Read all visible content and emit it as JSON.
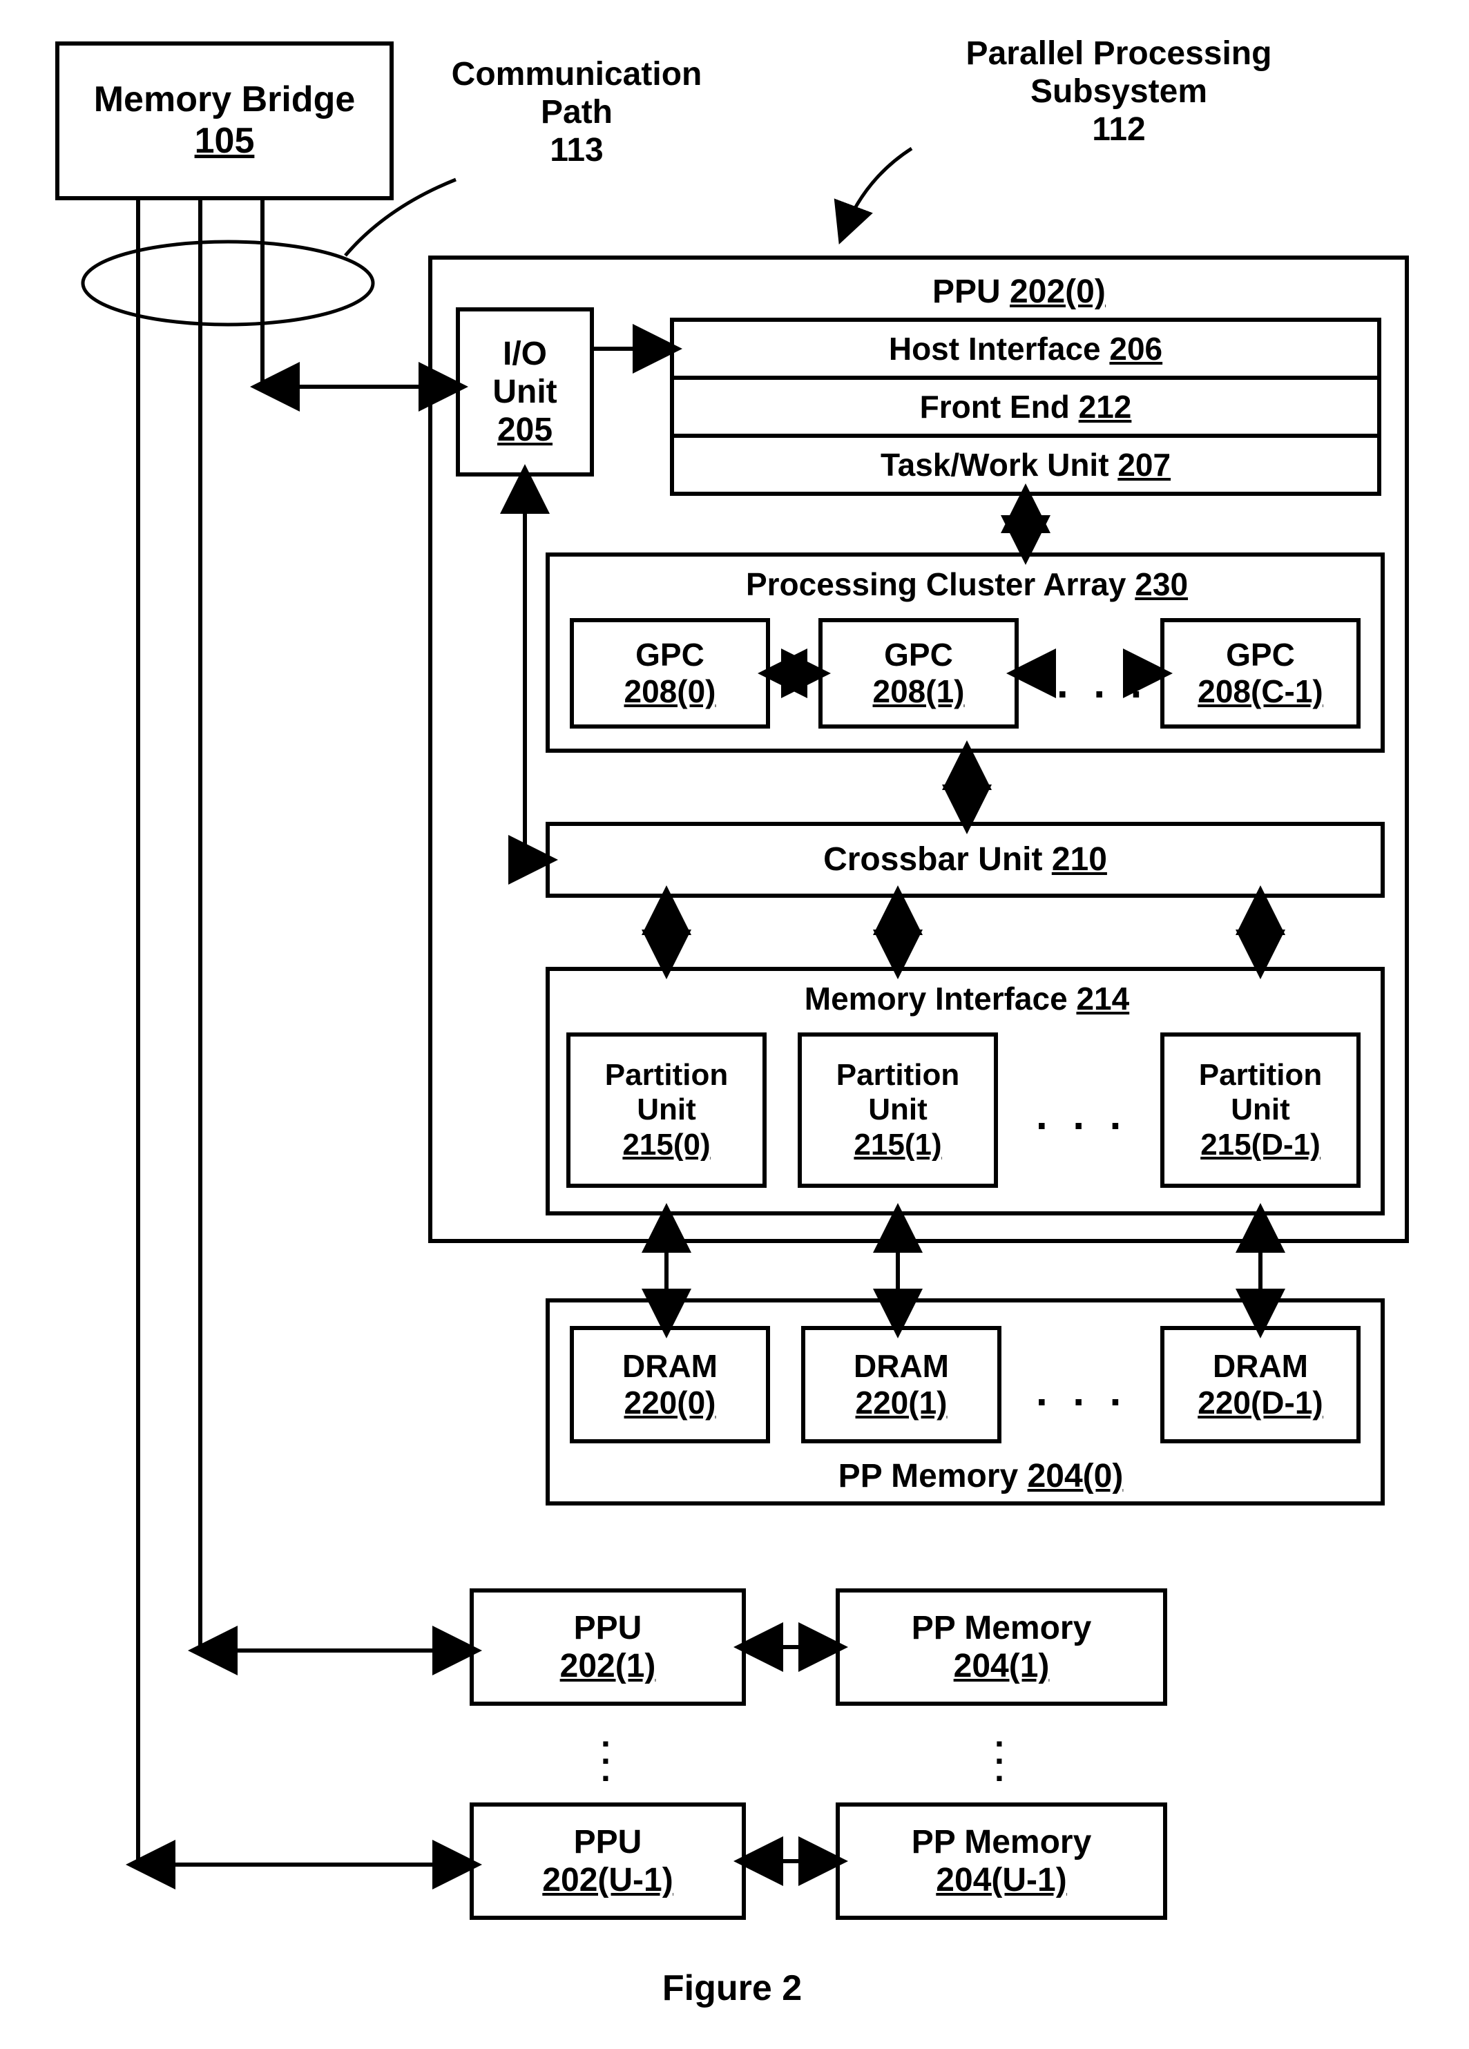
{
  "top": {
    "memory_bridge_title": "Memory Bridge",
    "memory_bridge_ref": "105",
    "comm_path_title": "Communication",
    "comm_path_title2": "Path",
    "comm_path_ref": "113",
    "pps_title": "Parallel Processing",
    "pps_title2": "Subsystem",
    "pps_ref": "112"
  },
  "ppu0": {
    "title": "PPU",
    "ref": "202(0)",
    "io_title": "I/O",
    "io_title2": "Unit",
    "io_ref": "205",
    "host_if": "Host Interface",
    "host_if_ref": "206",
    "front_end": "Front End",
    "front_end_ref": "212",
    "twu": "Task/Work Unit",
    "twu_ref": "207",
    "pca": "Processing Cluster Array",
    "pca_ref": "230",
    "gpc_label": "GPC",
    "gpc0_ref": "208(0)",
    "gpc1_ref": "208(1)",
    "gpcC_ref": "208(C-1)",
    "xbar": "Crossbar Unit",
    "xbar_ref": "210",
    "memif": "Memory Interface",
    "memif_ref": "214",
    "pu_label1": "Partition",
    "pu_label2": "Unit",
    "pu0_ref": "215(0)",
    "pu1_ref": "215(1)",
    "puD_ref": "215(D-1)"
  },
  "ppmem0": {
    "dram_label": "DRAM",
    "dram0_ref": "220(0)",
    "dram1_ref": "220(1)",
    "dramD_ref": "220(D-1)",
    "title": "PP Memory",
    "ref": "204(0)"
  },
  "ppu1": {
    "title": "PPU",
    "ref": "202(1)"
  },
  "ppmem1": {
    "title": "PP Memory",
    "ref": "204(1)"
  },
  "ppuU": {
    "title": "PPU",
    "ref": "202(U-1)"
  },
  "ppmemU": {
    "title": "PP Memory",
    "ref": "204(U-1)"
  },
  "figure": "Figure 2"
}
